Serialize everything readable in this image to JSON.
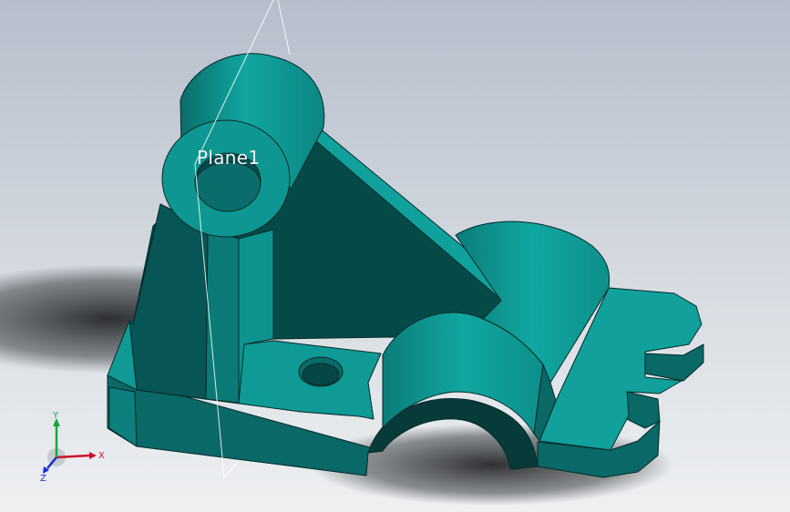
{
  "viewport": {
    "background_top": "#b4bdcc",
    "background_bottom": "#eceff2",
    "part_color": "#0d9c98",
    "part_dark": "#0a6e6c",
    "part_shadow": "#063f3e"
  },
  "annotations": {
    "plane_label": "Plane1"
  },
  "triad": {
    "x_label": "X",
    "y_label": "Y",
    "z_label": "Z",
    "x_color": "#d0102a",
    "y_color": "#1aa53a",
    "z_color": "#1a2ed0"
  }
}
